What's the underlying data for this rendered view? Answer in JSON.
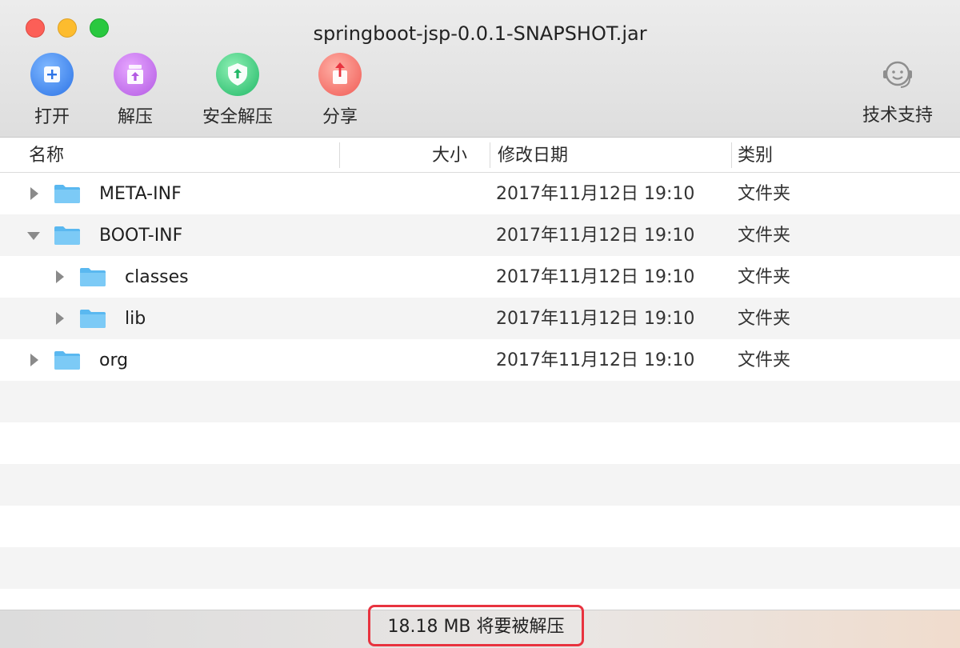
{
  "window": {
    "title": "springboot-jsp-0.0.1-SNAPSHOT.jar"
  },
  "toolbar": {
    "open_label": "打开",
    "extract_label": "解压",
    "safe_extract_label": "安全解压",
    "share_label": "分享",
    "support_label": "技术支持"
  },
  "columns": {
    "name": "名称",
    "size": "大小",
    "date": "修改日期",
    "type": "类别"
  },
  "files": [
    {
      "name": "META-INF",
      "date": "2017年11月12日 19:10",
      "type": "文件夹",
      "expanded": false,
      "depth": 0
    },
    {
      "name": "BOOT-INF",
      "date": "2017年11月12日 19:10",
      "type": "文件夹",
      "expanded": true,
      "depth": 0
    },
    {
      "name": "classes",
      "date": "2017年11月12日 19:10",
      "type": "文件夹",
      "expanded": false,
      "depth": 1
    },
    {
      "name": "lib",
      "date": "2017年11月12日 19:10",
      "type": "文件夹",
      "expanded": false,
      "depth": 1
    },
    {
      "name": "org",
      "date": "2017年11月12日 19:10",
      "type": "文件夹",
      "expanded": false,
      "depth": 0
    }
  ],
  "status": {
    "text": "18.18 MB 将要被解压"
  },
  "icons": {
    "open": "plus-icon",
    "extract": "extract-icon",
    "safe_extract": "shield-icon",
    "share": "share-icon",
    "support": "headset-icon",
    "folder": "folder-icon"
  },
  "colors": {
    "folder": "#5ab8f0",
    "highlight": "#e8333f",
    "close": "#fc5f57",
    "minimize": "#fdbc2e",
    "maximize": "#29c83f"
  }
}
